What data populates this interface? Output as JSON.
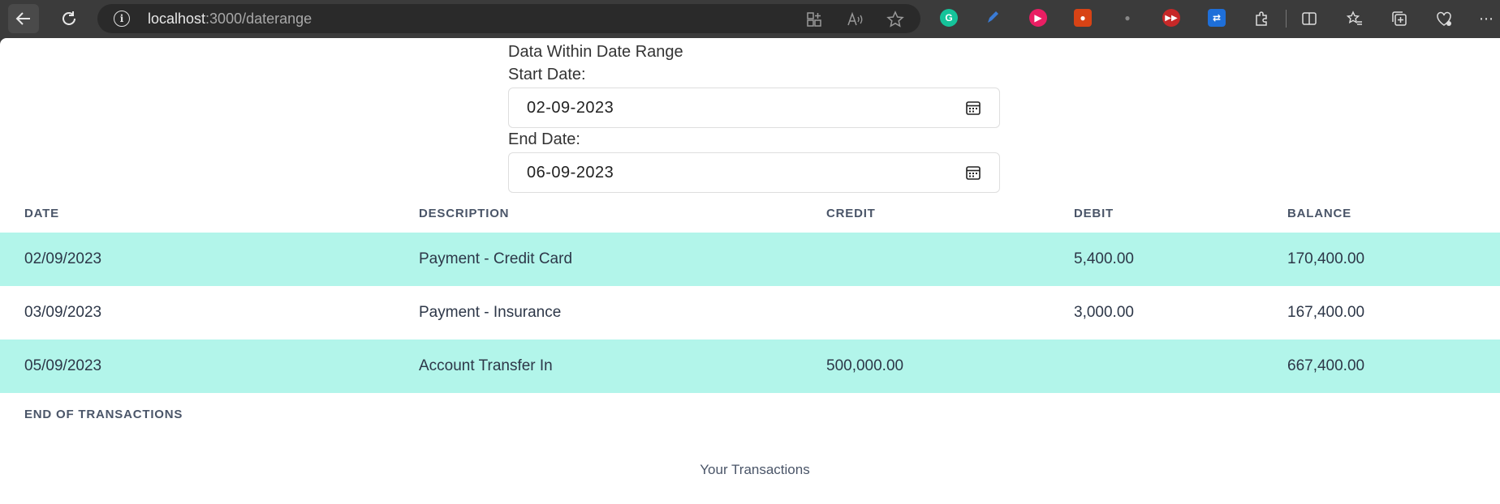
{
  "browser": {
    "url_host": "localhost",
    "url_path": ":3000/daterange"
  },
  "form": {
    "title": "Data Within Date Range",
    "start_label": "Start Date:",
    "start_value": "02-09-2023",
    "end_label": "End Date:",
    "end_value": "06-09-2023"
  },
  "table": {
    "headers": [
      "DATE",
      "DESCRIPTION",
      "CREDIT",
      "DEBIT",
      "BALANCE"
    ],
    "rows": [
      {
        "date": "02/09/2023",
        "description": "Payment - Credit Card",
        "credit": "",
        "debit": "5,400.00",
        "balance": "170,400.00"
      },
      {
        "date": "03/09/2023",
        "description": "Payment - Insurance",
        "credit": "",
        "debit": "3,000.00",
        "balance": "167,400.00"
      },
      {
        "date": "05/09/2023",
        "description": "Account Transfer In",
        "credit": "500,000.00",
        "debit": "",
        "balance": "667,400.00"
      }
    ],
    "footer": "END OF TRANSACTIONS"
  },
  "caption": "Your Transactions",
  "colors": {
    "row_highlight": "#b2f5ea",
    "header_text": "#4a5568"
  }
}
